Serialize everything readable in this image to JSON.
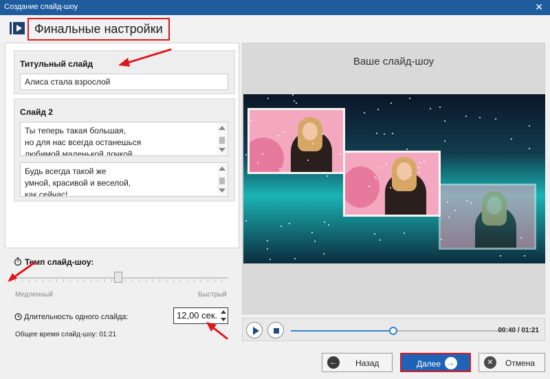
{
  "window": {
    "title": "Создание слайд-шоу",
    "close_glyph": "✕"
  },
  "header": {
    "title": "Финальные настройки",
    "logo_icon": "slideshow-logo-icon"
  },
  "title_slide": {
    "heading": "Титульный слайд",
    "value": "Алиса стала взрослой"
  },
  "slide2": {
    "heading": "Слайд 2",
    "text1": [
      "Ты теперь такая большая,",
      "но для нас всегда останешься",
      "любимой маленькой дочкой"
    ],
    "text2": [
      "Будь всегда такой же",
      "умной, красивой и веселой,",
      "как сейчас!"
    ]
  },
  "speed": {
    "label": "Темп слайд-шоу:",
    "slow": "Медленный",
    "fast": "Быстрый",
    "level": 0.5,
    "icon": "stopwatch-icon"
  },
  "duration": {
    "label": "Длительность одного слайда:",
    "value": "12,00 сек.",
    "icon": "clock-icon"
  },
  "total": {
    "text": "Общее время слайд-шоу: 01:21"
  },
  "preview": {
    "title": "Ваше слайд-шоу"
  },
  "player": {
    "time": "00:40 / 01:21",
    "progress": 0.49
  },
  "buttons": {
    "back": "Назад",
    "next": "Далее",
    "cancel": "Отмена"
  },
  "colors": {
    "accent": "#1e63b6",
    "highlight": "#e0161d",
    "titlebar": "#1f5c9e"
  }
}
